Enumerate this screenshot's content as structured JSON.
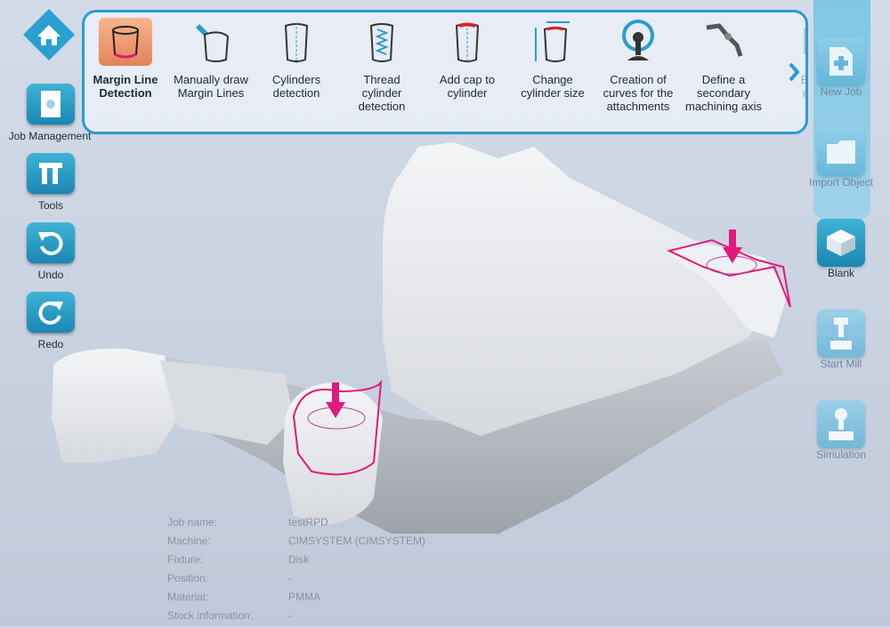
{
  "left_sidebar": {
    "items": [
      {
        "label": "Job Management",
        "icon": "door-icon"
      },
      {
        "label": "Tools",
        "icon": "tools-icon"
      },
      {
        "label": "Undo",
        "icon": "undo-icon"
      },
      {
        "label": "Redo",
        "icon": "redo-icon"
      }
    ]
  },
  "ribbon": {
    "tools": [
      {
        "label_lines": [
          "Margin Line",
          "Detection"
        ],
        "active": true
      },
      {
        "label_lines": [
          "Manually draw",
          "Margin Lines"
        ]
      },
      {
        "label_lines": [
          "Cylinders",
          "detection"
        ]
      },
      {
        "label_lines": [
          "Thread",
          "cylinder",
          "detection"
        ]
      },
      {
        "label_lines": [
          "Add cap to",
          "cylinder"
        ]
      },
      {
        "label_lines": [
          "Change",
          "cylinder size"
        ]
      },
      {
        "label_lines": [
          "Creation of",
          "curves for the",
          "attachments"
        ]
      },
      {
        "label_lines": [
          "Define a",
          "secondary",
          "machining axis"
        ]
      },
      {
        "label_lines": [
          "Edi",
          "en"
        ],
        "faded": true
      }
    ]
  },
  "right_sidebar": {
    "items": [
      {
        "label": "New Job",
        "icon": "new-job-icon",
        "active": false
      },
      {
        "label": "Import Object",
        "icon": "folder-icon",
        "active": false
      },
      {
        "label": "Blank",
        "icon": "blank-icon",
        "active": true
      },
      {
        "label": "Start Mill",
        "icon": "mill-icon",
        "active": false
      },
      {
        "label": "Simulation",
        "icon": "simulation-icon",
        "active": false
      }
    ]
  },
  "job_info": {
    "rows": [
      {
        "key": "Job name:",
        "value": "testRPD"
      },
      {
        "key": "Machine:",
        "value": "CIMSYSTEM (CIMSYSTEM)"
      },
      {
        "key": "Fixture:",
        "value": "Disk"
      },
      {
        "key": "Position:",
        "value": "-"
      },
      {
        "key": "Material:",
        "value": "PMMA"
      },
      {
        "key": "Stock information:",
        "value": "-"
      }
    ]
  },
  "colors": {
    "accent": "#2c9bd0",
    "button": "#1b86b4",
    "margin_line": "#e0197d",
    "model": "#e9ebef"
  }
}
